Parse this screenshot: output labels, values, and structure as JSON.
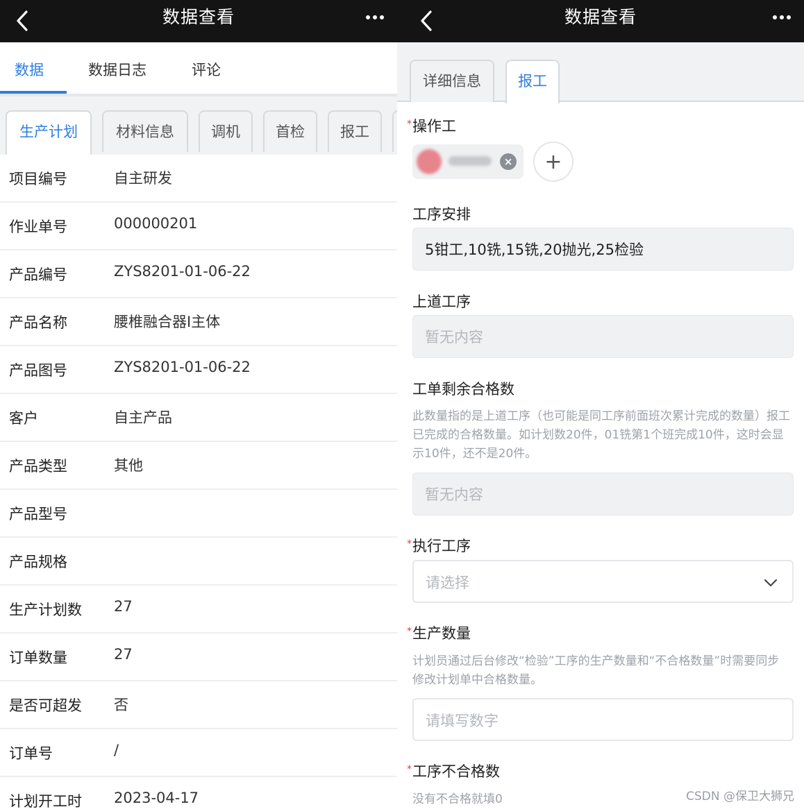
{
  "left": {
    "title": "数据查看",
    "tabs": [
      "数据",
      "数据日志",
      "评论"
    ],
    "subtabs": [
      "生产计划",
      "材料信息",
      "调机",
      "首检",
      "报工"
    ],
    "rows": [
      {
        "label": "项目编号",
        "value": "自主研发"
      },
      {
        "label": "作业单号",
        "value": "000000201"
      },
      {
        "label": "产品编号",
        "value": "ZYS8201-01-06-22"
      },
      {
        "label": "产品名称",
        "value": "腰椎融合器I主体"
      },
      {
        "label": "产品图号",
        "value": "ZYS8201-01-06-22"
      },
      {
        "label": "客户",
        "value": "自主产品"
      },
      {
        "label": "产品类型",
        "value": "其他"
      },
      {
        "label": "产品型号",
        "value": ""
      },
      {
        "label": "产品规格",
        "value": ""
      },
      {
        "label": "生产计划数",
        "value": "27"
      },
      {
        "label": "订单数量",
        "value": "27"
      },
      {
        "label": "是否可超发",
        "value": "否"
      },
      {
        "label": "订单号",
        "value": "/"
      },
      {
        "label": "计划开工时",
        "value": "2023-04-17"
      }
    ]
  },
  "right": {
    "title": "数据查看",
    "tabs": [
      "详细信息",
      "报工"
    ],
    "required_mark": "*",
    "operator_label": "操作工",
    "process_label": "工序安排",
    "process_value": "5钳工,10铣,15铣,20抛光,25检验",
    "prev_process_label": "上道工序",
    "prev_process_placeholder": "暂无内容",
    "remaining_label": "工单剩余合格数",
    "remaining_desc": "此数量指的是上道工序（也可能是同工序前面班次累计完成的数量）报工已完成的合格数量。如计划数20件，01铣第1个班完成10件，这时会显示10件，还不是20件。",
    "remaining_placeholder": "暂无内容",
    "exec_process_label": "执行工序",
    "exec_process_placeholder": "请选择",
    "qty_label": "生产数量",
    "qty_desc": "计划员通过后台修改“检验”工序的生产数量和“不合格数量”时需要同步修改计划单中合格数量。",
    "qty_placeholder": "请填写数字",
    "defect_label": "工序不合格数",
    "defect_desc": "没有不合格就填0",
    "add_symbol": "+",
    "remove_symbol": "×"
  },
  "watermark": "CSDN @保卫大狮兄",
  "colors": {
    "accent": "#2f7fe0",
    "topbar": "#141414",
    "required": "#e23b3b"
  }
}
